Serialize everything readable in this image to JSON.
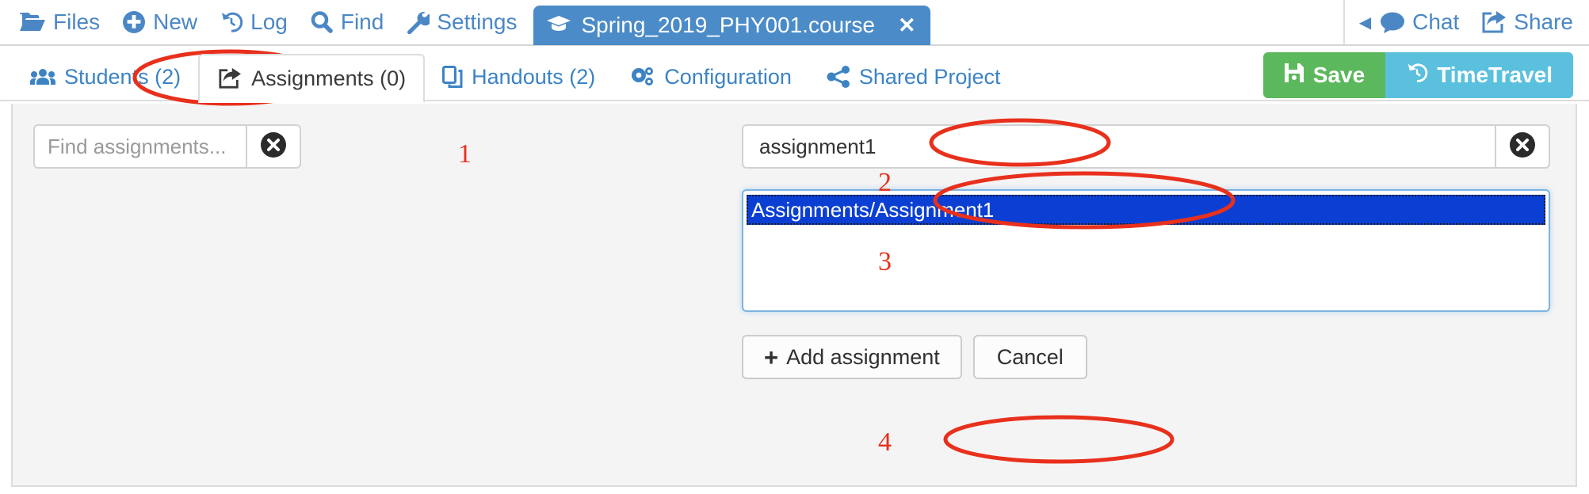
{
  "toolbar": {
    "items": [
      {
        "label": "Files",
        "icon": "folder-open-icon"
      },
      {
        "label": "New",
        "icon": "plus-circle-icon"
      },
      {
        "label": "Log",
        "icon": "history-icon"
      },
      {
        "label": "Find",
        "icon": "search-icon"
      },
      {
        "label": "Settings",
        "icon": "wrench-icon"
      }
    ],
    "open_tab": {
      "label": "Spring_2019_PHY001.course",
      "icon": "graduation-cap-icon",
      "close": "✕"
    },
    "right_items": [
      {
        "label": "Chat",
        "icon": "comment-icon"
      },
      {
        "label": "Share",
        "icon": "share-square-icon"
      }
    ]
  },
  "nav": {
    "tabs": [
      {
        "label": "Students (2)",
        "icon": "users-icon",
        "active": false
      },
      {
        "label": "Assignments (0)",
        "icon": "share-square-icon",
        "active": true
      },
      {
        "label": "Handouts (2)",
        "icon": "copy-icon",
        "active": false
      },
      {
        "label": "Configuration",
        "icon": "cogs-icon",
        "active": false
      },
      {
        "label": "Shared Project",
        "icon": "share-alt-icon",
        "active": false
      }
    ],
    "save_label": "Save",
    "save_icon": "save-icon",
    "timetravel_label": "TimeTravel",
    "timetravel_icon": "history-icon"
  },
  "content": {
    "search": {
      "value": "",
      "placeholder": "Find assignments...",
      "clear_icon": "times-circle-icon"
    },
    "name_field": {
      "value": "assignment1",
      "placeholder": "",
      "clear_icon": "times-circle-icon"
    },
    "path_list": {
      "items": [
        "Assignments/Assignment1"
      ],
      "selected_index": 0
    },
    "add_label": "Add assignment",
    "add_icon": "plus-icon",
    "cancel_label": "Cancel"
  },
  "annotations": {
    "numbers": [
      "1",
      "2",
      "3",
      "4"
    ],
    "color": "#e8301c"
  },
  "colors": {
    "link_blue": "#3c83c4",
    "tab_blue": "#4b8bc8",
    "save_green": "#5cb85c",
    "timetravel_blue": "#5bc0de",
    "selection_blue": "#0b3fd4",
    "annotation_red": "#e8301c",
    "panel_gray": "#f4f4f4"
  }
}
